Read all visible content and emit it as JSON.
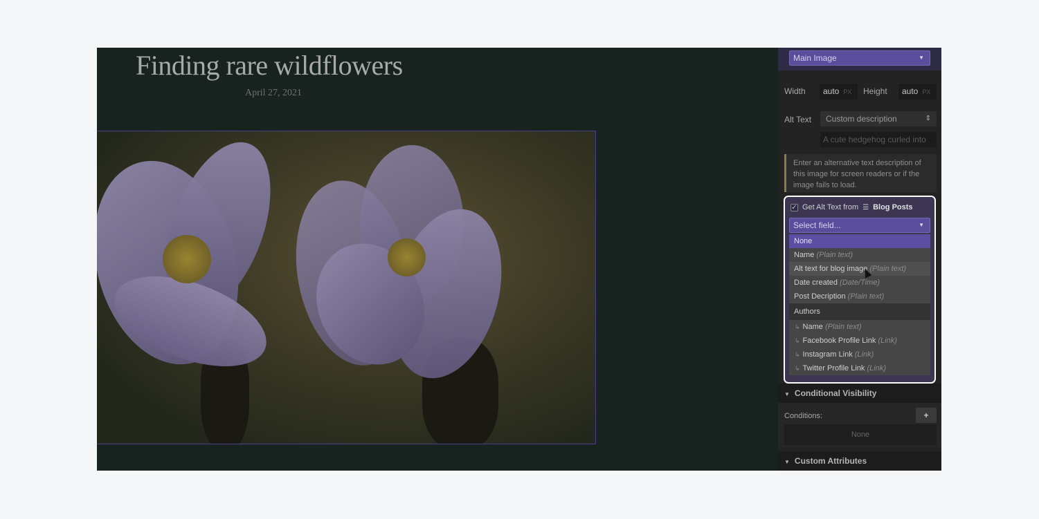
{
  "article": {
    "title": "Finding rare wildflowers",
    "date": "April 27, 2021"
  },
  "panel": {
    "image_select": "Main Image",
    "width_label": "Width",
    "width_value": "auto",
    "width_unit": "PX",
    "height_label": "Height",
    "height_value": "auto",
    "height_unit": "PX",
    "alt_label": "Alt Text",
    "alt_mode": "Custom description",
    "alt_placeholder": "A cute hedgehog curled into",
    "note": "Enter an alternative text description of this image for screen readers or if the image fails to load."
  },
  "popup": {
    "checkbox_label": "Get Alt Text from",
    "collection": "Blog Posts",
    "checked": true,
    "select_placeholder": "Select field...",
    "options": [
      {
        "name": "None",
        "type": ""
      },
      {
        "name": "Name",
        "type": "(Plain text)"
      },
      {
        "name": "Alt text for blog image",
        "type": "(Plain text)"
      },
      {
        "name": "Date created",
        "type": "(Date/Time)"
      },
      {
        "name": "Post Decription",
        "type": "(Plain text)"
      }
    ],
    "group": "Authors",
    "sub_options": [
      {
        "name": "Name",
        "type": "(Plain text)"
      },
      {
        "name": "Facebook Profile Link",
        "type": "(Link)"
      },
      {
        "name": "Instagram Link",
        "type": "(Link)"
      },
      {
        "name": "Twitter Profile Link",
        "type": "(Link)"
      }
    ]
  },
  "visibility": {
    "title": "Conditional Visibility",
    "conditions_label": "Conditions:",
    "add": "+",
    "empty": "None"
  },
  "attributes": {
    "title": "Custom Attributes"
  },
  "colors": {
    "accent": "#5c4fa3",
    "canvas": "#18221e",
    "panel": "#232323"
  }
}
